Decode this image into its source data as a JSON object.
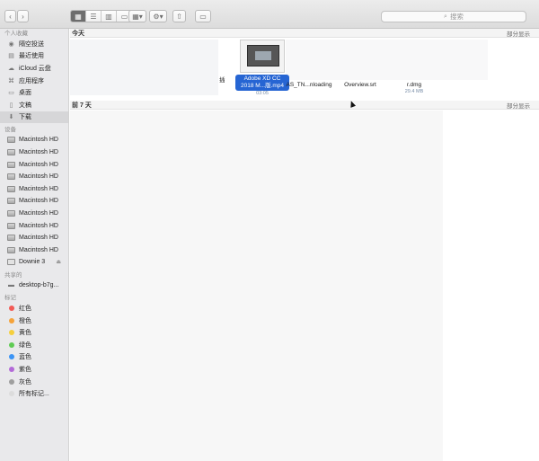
{
  "toolbar": {
    "back_icon": "chevron-left-icon",
    "forward_icon": "chevron-right-icon",
    "view_modes": [
      "icon-view-icon",
      "list-view-icon",
      "column-view-icon",
      "gallery-view-icon"
    ],
    "arrange_icon": "grid-arrange-icon",
    "action_icon": "gear-icon",
    "share_icon": "share-icon",
    "tag_icon": "tag-icon",
    "search_placeholder": "搜索"
  },
  "sidebar": {
    "favorites_title": "个人收藏",
    "favorites": [
      {
        "label": "隔空投送",
        "icon": "airdrop-icon"
      },
      {
        "label": "最近使用",
        "icon": "recents-icon"
      },
      {
        "label": "iCloud 云盘",
        "icon": "cloud-icon"
      },
      {
        "label": "应用程序",
        "icon": "applications-icon"
      },
      {
        "label": "桌面",
        "icon": "desktop-icon"
      },
      {
        "label": "文稿",
        "icon": "document-icon"
      },
      {
        "label": "下载",
        "icon": "download-icon",
        "selected": true
      }
    ],
    "devices_title": "设备",
    "devices": [
      {
        "label": "Macintosh HD"
      },
      {
        "label": "Macintosh HD"
      },
      {
        "label": "Macintosh HD"
      },
      {
        "label": "Macintosh HD"
      },
      {
        "label": "Macintosh HD"
      },
      {
        "label": "Macintosh HD"
      },
      {
        "label": "Macintosh HD"
      },
      {
        "label": "Macintosh HD"
      },
      {
        "label": "Macintosh HD"
      },
      {
        "label": "Macintosh HD"
      },
      {
        "label": "Downie 3",
        "eject": true
      }
    ],
    "shared_title": "共享的",
    "shared": [
      {
        "label": "desktop-b7g..."
      }
    ],
    "tags_title": "标记",
    "tags": [
      {
        "label": "红色",
        "color": "#f25a55"
      },
      {
        "label": "橙色",
        "color": "#f5a33a"
      },
      {
        "label": "黄色",
        "color": "#f5cf3d"
      },
      {
        "label": "绿色",
        "color": "#5fcb54"
      },
      {
        "label": "蓝色",
        "color": "#3c94f5"
      },
      {
        "label": "紫色",
        "color": "#b36ad8"
      },
      {
        "label": "灰色",
        "color": "#9e9e9e"
      },
      {
        "label": "所有标记...",
        "color": "#dcdcdc"
      }
    ]
  },
  "main": {
    "group_today": "今天",
    "group_more_label": "部分显示",
    "group_two": "前 7 天",
    "files": {
      "partial_left": "插",
      "selected_line1": "Adobe XD CC",
      "selected_line2": "2018 M...版.mp4",
      "selected_meta": "03:05",
      "file2": "AS_TN...nloading",
      "file3": "Overview.srt",
      "file4": "r.dmg",
      "file4_meta": "29.4 MB"
    }
  }
}
